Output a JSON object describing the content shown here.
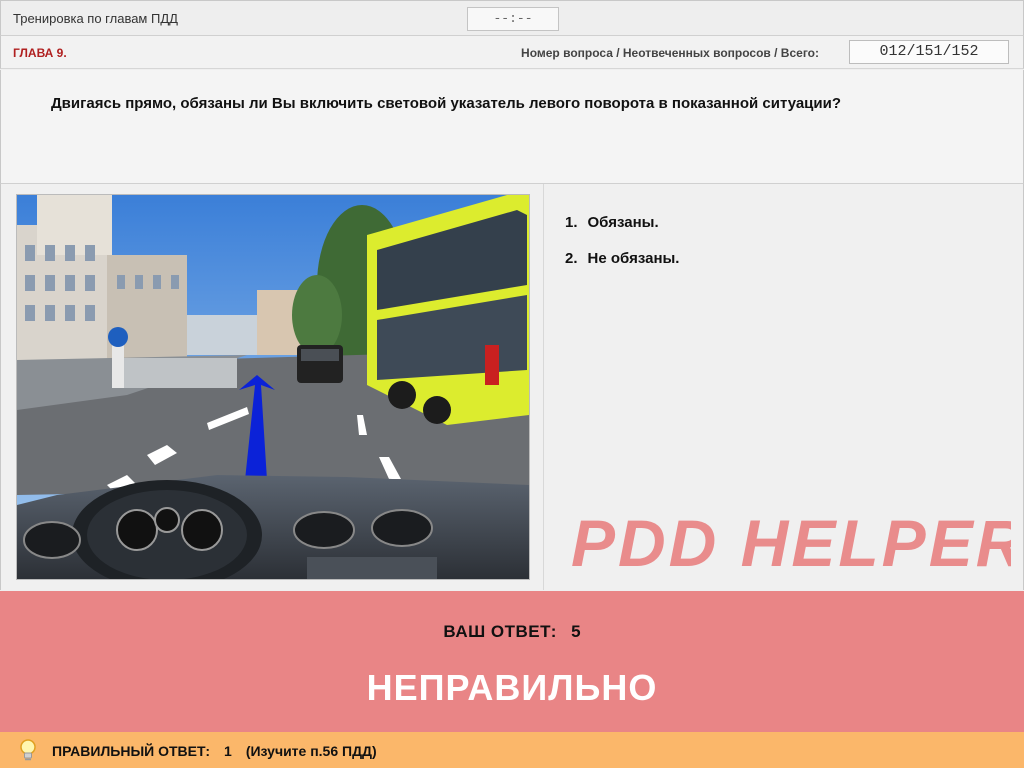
{
  "header": {
    "title": "Тренировка по главам ПДД",
    "timer": "--:--"
  },
  "infobar": {
    "chapter": "ГЛАВА 9.",
    "counter_label": "Номер вопроса / Неотвеченных вопросов / Всего:",
    "counter": "012/151/152"
  },
  "question": {
    "text": "Двигаясь прямо, обязаны ли Вы включить световой указатель левого поворота в показанной ситуации?"
  },
  "answers": [
    {
      "num": "1.",
      "label": "Обязаны."
    },
    {
      "num": "2.",
      "label": "Не обязаны."
    }
  ],
  "watermark": "PDD HELPER",
  "result": {
    "your_answer_label": "ВАШ ОТВЕТ:",
    "your_answer_value": "5",
    "verdict": "НЕПРАВИЛЬНО"
  },
  "hint": {
    "label": "ПРАВИЛЬНЫЙ ОТВЕТ:",
    "value": "1",
    "note": "(Изучите п.56 ПДД)"
  },
  "colors": {
    "result_bg": "#e98586",
    "hint_bg": "#fbb76a",
    "chapter": "#b02020",
    "watermark": "#e98c8c"
  },
  "icons": {
    "bulb": "lightbulb-icon",
    "arrow": "direction-arrow"
  }
}
